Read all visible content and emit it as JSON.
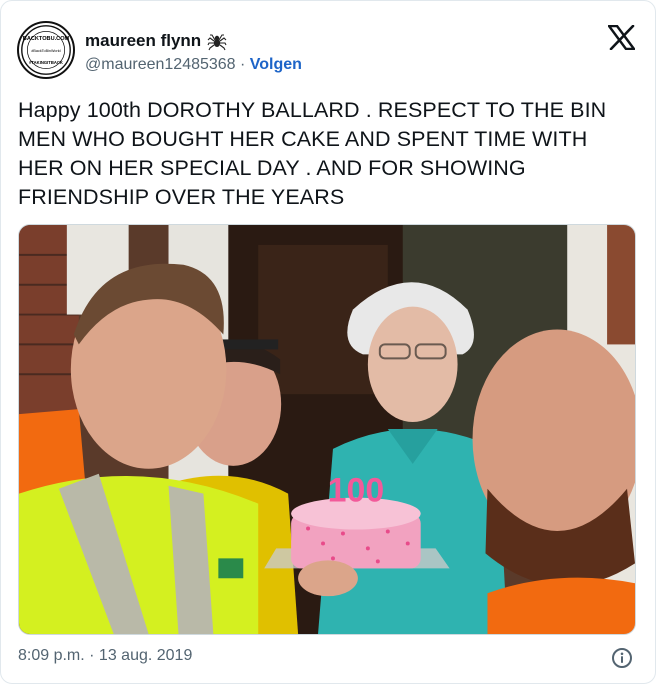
{
  "tweet": {
    "author_name": "maureen flynn",
    "author_handle": "@maureen12485368",
    "separator": " · ",
    "follow_label": "Volgen",
    "avatar_badge_top": "BACKTOBU.COM",
    "avatar_badge_mid": "#BackToBinWorld",
    "avatar_badge_bottom": "#TAKINGITBACK",
    "body_text": "Happy 100th DOROTHY BALLARD  . RESPECT TO THE BIN MEN WHO BOUGHT HER CAKE AND SPENT TIME WITH HER ON HER SPECIAL DAY . AND FOR SHOWING FRIENDSHIP OVER THE YEARS",
    "cake_number": "100",
    "timestamp": "8:09 p.m. · 13 aug. 2019"
  },
  "icons": {
    "author_emoji": "spider-icon",
    "brand": "x-logo-icon",
    "info": "info-icon"
  },
  "colors": {
    "text": "#0f1419",
    "muted": "#536471",
    "link": "#1d64c8",
    "hi_vis_yellow": "#d4f020",
    "hi_vis_orange": "#f26a10",
    "blouse_teal": "#2fb3b0",
    "cake_pink": "#f2a2c0"
  }
}
